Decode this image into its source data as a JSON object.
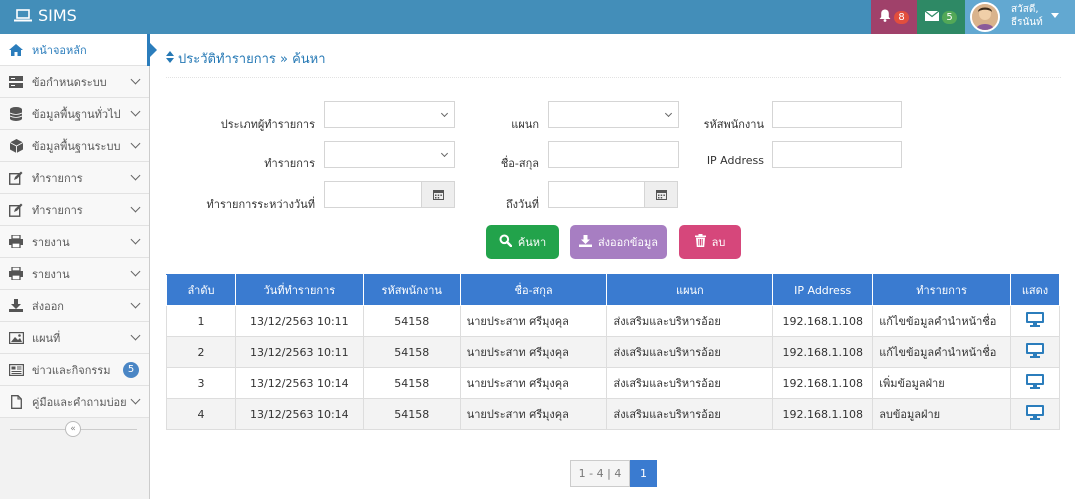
{
  "app": {
    "title": "SIMS"
  },
  "topbar": {
    "notifications": {
      "count": "8"
    },
    "messages": {
      "count": "5"
    },
    "user": {
      "greeting": "สวัสดี,",
      "name": "ธีรนันท์"
    }
  },
  "sidebar": {
    "items": [
      {
        "label": "หน้าจอหลัก",
        "icon": "home-icon"
      },
      {
        "label": "ข้อกำหนดระบบ",
        "icon": "server-icon"
      },
      {
        "label": "ข้อมูลพื้นฐานทั่วไป",
        "icon": "database-icon"
      },
      {
        "label": "ข้อมูลพื้นฐานระบบ",
        "icon": "cube-icon"
      },
      {
        "label": "ทำรายการ",
        "icon": "edit-icon"
      },
      {
        "label": "ทำรายการ",
        "icon": "edit-icon"
      },
      {
        "label": "รายงาน",
        "icon": "print-icon"
      },
      {
        "label": "รายงาน",
        "icon": "print-icon"
      },
      {
        "label": "ส่งออก",
        "icon": "download-icon"
      },
      {
        "label": "แผนที่",
        "icon": "image-icon"
      },
      {
        "label": "ข่าวและกิจกรรม",
        "icon": "newspaper-icon",
        "badge": "5"
      },
      {
        "label": "คู่มือและคำถามบ่อย",
        "icon": "file-icon"
      }
    ],
    "collapse_label": "«"
  },
  "page": {
    "breadcrumb": "ประวัติทำรายการ » ค้นหา"
  },
  "filters": {
    "user_type_label": "ประเภทผู้ทำรายการ",
    "user_type_value": "",
    "department_label": "แผนก",
    "department_value": "",
    "employee_id_label": "รหัสพนักงาน",
    "employee_id_value": "",
    "action_label": "ทำรายการ",
    "action_value": "",
    "name_label": "ชื่อ-สกุล",
    "name_value": "",
    "ip_label": "IP Address",
    "ip_value": "",
    "date_from_label": "ทำรายการระหว่างวันที่",
    "date_from_value": "",
    "date_to_label": "ถึงวันที่",
    "date_to_value": ""
  },
  "buttons": {
    "search": "ค้นหา",
    "export": "ส่งออกข้อมูล",
    "delete": "ลบ"
  },
  "table": {
    "headers": [
      "ลำดับ",
      "วันที่ทำรายการ",
      "รหัสพนักงาน",
      "ชื่อ-สกุล",
      "แผนก",
      "IP Address",
      "ทำรายการ",
      "แสดง"
    ],
    "rows": [
      [
        "1",
        "13/12/2563 10:11",
        "54158",
        "นายประสาท ศรีมุงคุล",
        "ส่งเสริมและบริหารอ้อย",
        "192.168.1.108",
        "แก้ไขข้อมูลคำนำหน้าชื่อ"
      ],
      [
        "2",
        "13/12/2563 10:11",
        "54158",
        "นายประสาท ศรีมุงคุล",
        "ส่งเสริมและบริหารอ้อย",
        "192.168.1.108",
        "แก้ไขข้อมูลคำนำหน้าชื่อ"
      ],
      [
        "3",
        "13/12/2563 10:14",
        "54158",
        "นายประสาท ศรีมุงคุล",
        "ส่งเสริมและบริหารอ้อย",
        "192.168.1.108",
        "เพิ่มข้อมูลฝ่าย"
      ],
      [
        "4",
        "13/12/2563 10:14",
        "54158",
        "นายประสาท ศรีมุงคุล",
        "ส่งเสริมและบริหารอ้อย",
        "192.168.1.108",
        "ลบข้อมูลฝ่าย"
      ]
    ]
  },
  "pagination": {
    "info": "1 - 4 | 4",
    "current": "1"
  },
  "colors": {
    "topbar": "#438eb9",
    "accent": "#2b7dbc",
    "table_header": "#3a7bd0",
    "search": "#22a34b",
    "export": "#a77ec2",
    "delete": "#d6477b"
  }
}
